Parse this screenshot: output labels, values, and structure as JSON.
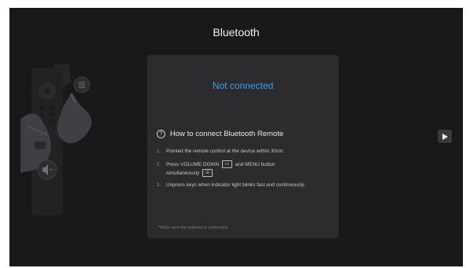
{
  "page": {
    "title": "Bluetooth"
  },
  "panel": {
    "status": "Not connected",
    "help_icon": "question-circle-icon",
    "help_title": "How to connect Bluetooth Remote",
    "steps": [
      {
        "number": "1.",
        "text": "Pointed the remote control at the device within 30cm."
      },
      {
        "number": "2.",
        "text_before": "Press VOLUME DOWN",
        "volume_key_icon": "volume-down-key-icon",
        "text_middle": "and MENU button",
        "text_after": "simultaneously",
        "menu_key_icon": "menu-key-icon"
      },
      {
        "number": "3.",
        "text": "Unpress keys when indicator light blinks fast and continuously."
      }
    ],
    "note": "*Make sure the antenna is connected."
  },
  "illustration": {
    "name": "remote-control-illustration",
    "icons": [
      "volume-down-icon",
      "menu-icon"
    ]
  },
  "navigation": {
    "next_icon": "play-right-icon"
  },
  "colors": {
    "background": "#19191b",
    "panel": "#2c2c2f",
    "status": "#35a0f0",
    "title": "#f2f2f2"
  }
}
